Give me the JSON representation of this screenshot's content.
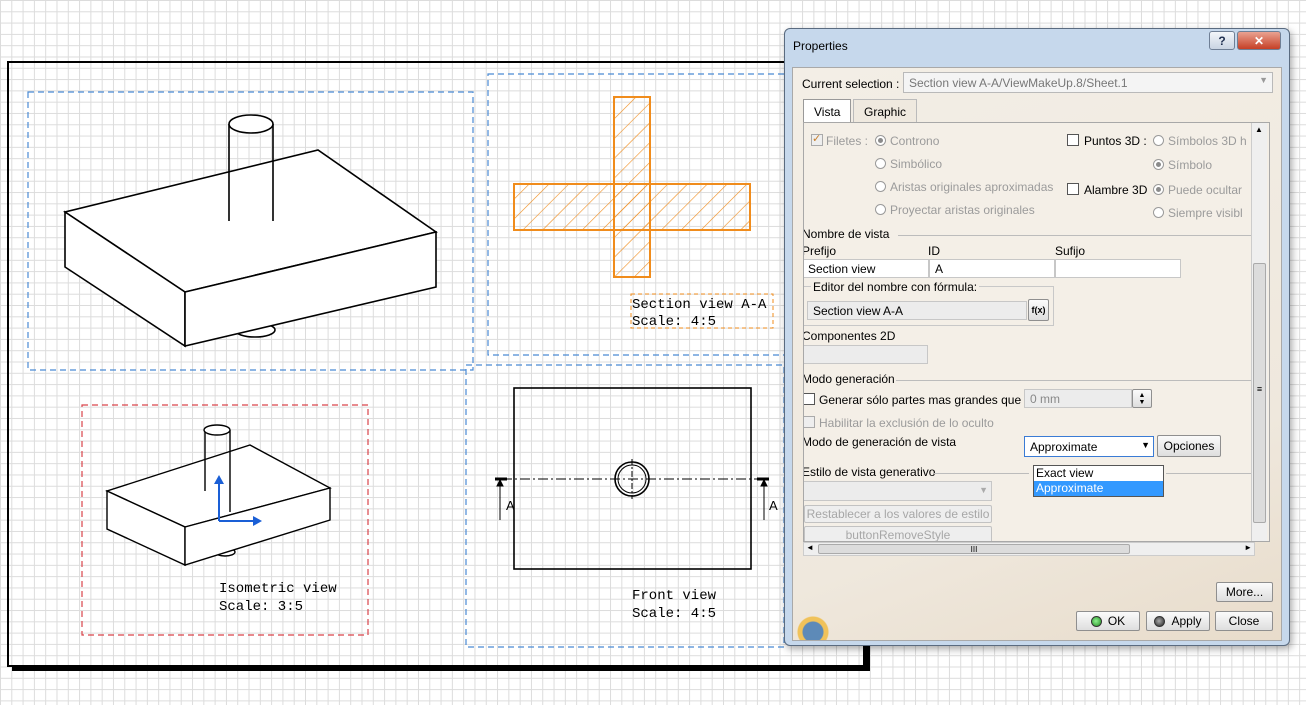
{
  "drawing": {
    "section_view": {
      "title": "Section view A-A",
      "scale": "Scale:  4:5"
    },
    "isometric_view": {
      "title": "Isometric view",
      "scale": "Scale:  3:5"
    },
    "front_view": {
      "title": "Front view",
      "scale": "Scale:  4:5"
    },
    "section_marker_letter": "A",
    "colors": {
      "frame_blue": "#4a8ad4",
      "frame_red": "#d9434a",
      "section_orange": "#f08c1c",
      "axis_blue": "#1a5fd6"
    }
  },
  "dialog": {
    "title": "Properties",
    "help_icon": "?",
    "close_icon": "✕",
    "current_selection_label": "Current selection :",
    "current_selection_value": "Section view A-A/ViewMakeUp.8/Sheet.1",
    "tabs": [
      "Vista",
      "Graphic"
    ],
    "active_tab": "Vista",
    "vista": {
      "filetes_label": "Filetes :",
      "filetes_options": [
        "Controno",
        "Simbólico",
        "Aristas originales aproximadas",
        "Proyectar aristas originales"
      ],
      "puntos3d_label": "Puntos 3D :",
      "puntos3d_options": [
        "Símbolos 3D h"
      ],
      "simbolo_option": "Símbolo",
      "alambre3d_label": "Alambre 3D",
      "alambre_options": [
        "Puede ocultar",
        "Siempre visibl"
      ],
      "nombre_de_vista_header": "Nombre de vista",
      "prefijo_label": "Prefijo",
      "id_label": "ID",
      "sufijo_label": "Sufijo",
      "prefijo_value": "Section view",
      "id_value": "A",
      "sufijo_value": "",
      "editor_formula_label": "Editor del nombre con fórmula:",
      "editor_formula_value": "Section view A-A",
      "fx_icon": "f(x)",
      "componentes2d_label": "Componentes 2D",
      "modo_generacion_header": "Modo generación",
      "generar_label": "Generar sólo partes mas grandes que",
      "generar_value": "0 mm",
      "habilitar_label": "Habilitar la exclusión de lo oculto",
      "modo_vista_label": "Modo de generación de vista",
      "modo_vista_selected": "Approximate",
      "modo_vista_options": [
        "Exact view",
        "Approximate"
      ],
      "opciones_button": "Opciones",
      "estilo_header": "Estilo de vista generativo",
      "restablecer_button": "Restablecer a los valores de estilo",
      "remove_style_button": "buttonRemoveStyle",
      "hscroll_grip": "III",
      "vscroll_grip": "≡"
    },
    "more_button": "More...",
    "ok_button": "OK",
    "apply_button": "Apply",
    "close_button": "Close"
  }
}
